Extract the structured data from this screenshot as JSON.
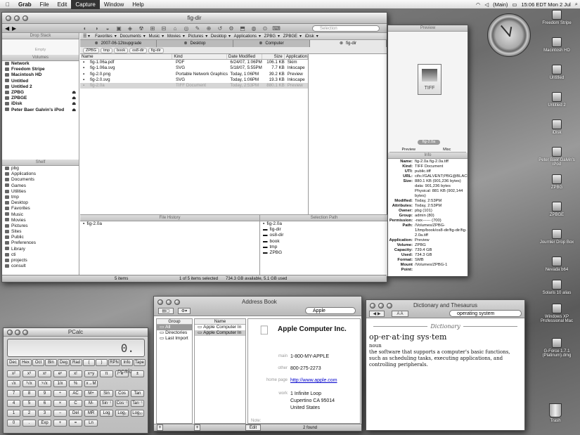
{
  "menubar": {
    "apple": "",
    "app": "Grab",
    "items": [
      "File",
      "Edit",
      "Capture",
      "Window",
      "Help"
    ],
    "clock": "15:06 EDT Mon 2 Jul",
    "main_label": "(Main)"
  },
  "pathfinder": {
    "title": "fig-dir",
    "search_placeholder": "Selection",
    "drop_stack": "Drop Stack",
    "drop_empty": "Empty",
    "volumes_label": "Volumes",
    "shelf_label": "Shelf",
    "file_history_label": "File History",
    "selection_path_label": "Selection Path",
    "preview_label": "Preview",
    "info_label": "Info",
    "tabs": [
      "2007-06-12toupgrade",
      "Desktop",
      "Computer",
      "fig-dir"
    ],
    "bookmarks": [
      "Favorites",
      "Documents",
      "Music",
      "Movies",
      "Pictures",
      "Desktop",
      "Applications",
      "ZPBG",
      "ZPBGE",
      "iDisk"
    ],
    "path": [
      "ZPBG",
      "tmp",
      "book",
      "os8-dir",
      "fig-dir"
    ],
    "volumes": [
      {
        "name": "Network",
        "bold": true
      },
      {
        "name": "Freedom Stripe",
        "bold": true
      },
      {
        "name": "Macintosh HD",
        "bold": true
      },
      {
        "name": "Untitled",
        "bold": true
      },
      {
        "name": "Untitled 2",
        "bold": true
      },
      {
        "name": "ZPBG",
        "bold": true,
        "eject": true
      },
      {
        "name": "ZPBGE",
        "bold": true,
        "eject": true
      },
      {
        "name": "iDisk",
        "bold": true,
        "eject": true
      },
      {
        "name": "Peter Baer Galvin's iPod",
        "bold": true,
        "eject": true
      }
    ],
    "shelf": [
      "pbg",
      "Applications",
      "Documents",
      "Games",
      "Utilities",
      "tmp",
      "Desktop",
      "Favorites",
      "Music",
      "Movies",
      "Pictures",
      "Sites",
      "Public",
      "Preferences",
      "Library",
      "cti",
      "projects",
      "consult"
    ],
    "columns": [
      "Name",
      "Kind",
      "Date Modified",
      "Size",
      "Application"
    ],
    "files": [
      {
        "name": "fig-1.06a.pdf",
        "kind": "PDF",
        "date": "6/24/07, 1:06PM",
        "size": "106.1 KB",
        "app": "Skim"
      },
      {
        "name": "fig-1.06a.svg",
        "kind": "SVG",
        "date": "5/18/07, 5:55PM",
        "size": "7.7 KB",
        "app": "Inkscape"
      },
      {
        "name": "fig-2.0.png",
        "kind": "Portable Network Graphics Image",
        "date": "Today, 1:06PM",
        "size": "39.2 KB",
        "app": "Preview"
      },
      {
        "name": "fig-2.0.svg",
        "kind": "SVG",
        "date": "Today, 1:06PM",
        "size": "19.3 KB",
        "app": "Inkscape"
      },
      {
        "name": "fig-2.0a",
        "kind": "TIFF Document",
        "date": "Today, 2:53PM",
        "size": "880.1 KB",
        "app": "Preview"
      }
    ],
    "file_history": [
      "fig-2.0a"
    ],
    "selection_path": [
      "fig-2.0a",
      "fig-dir",
      "os8-dir",
      "book",
      "tmp",
      "ZPBG"
    ],
    "preview_caption": "fig-2.0a",
    "preview_tabs": [
      "Preview",
      "Misc"
    ],
    "preview_icon_label": "TIFF",
    "info": [
      {
        "k": "Name:",
        "v": "fig-2.0a fig-2.0a.tiff"
      },
      {
        "k": "Kind:",
        "v": "TIFF Document"
      },
      {
        "k": "UTI:",
        "v": "public.tiff"
      },
      {
        "k": "URL:",
        "v": "cifs://GALVENT;PBG@BLACKSUN/ZPBG"
      },
      {
        "k": "Size:",
        "v": "880.1 KB (901,236 bytes) data: 901,236 bytes Physical: 881 KB (902,144 bytes)"
      },
      {
        "k": "Modified:",
        "v": "Today, 2:53PM"
      },
      {
        "k": "Attributes:",
        "v": "Today, 2:53PM"
      },
      {
        "k": "Owner:",
        "v": "pbg (101)"
      },
      {
        "k": "Group:",
        "v": "admin (80)"
      },
      {
        "k": "Permission:",
        "v": "-rwx------ (700)"
      },
      {
        "k": "Path:",
        "v": "/Volumes/ZPBG-1/tmp/book/os8-dir/fig-dir/fig-2.0a.tiff"
      },
      {
        "k": "Application:",
        "v": "Preview"
      },
      {
        "k": "Volume:",
        "v": "ZPBG"
      },
      {
        "k": "Capacity:",
        "v": "739.4 GB"
      },
      {
        "k": "Used:",
        "v": "734.3 GB"
      },
      {
        "k": "Format:",
        "v": "SMB"
      },
      {
        "k": "Mount Point:",
        "v": "/Volumes/ZPBG-1"
      }
    ],
    "status_items": "5 items",
    "status_sel": "1 of 5 items selected",
    "status_space": "734.3 GB available, 5.1 GB used"
  },
  "desktop_icons": [
    "Freedom Stripe",
    "Macintosh HD",
    "Untitled",
    "Untitled 2",
    "iDisk",
    "Peter Baer Galvin's iPod",
    "ZPBG",
    "ZPBGE",
    "Journler Drop Box",
    "Nevada b64",
    "Solaris 10 alias",
    "Windows XP Professional Mac",
    "G-Force 1.7.1 (Platinum).dmg"
  ],
  "trash": "Trash",
  "pcalc": {
    "title": "PCalc",
    "display": "0.",
    "logo": "pcalc",
    "row_modes": [
      "Dec",
      "Hex",
      "Oct",
      "Bin",
      "Deg",
      "Rad",
      "(",
      ")",
      "RPN",
      "Info",
      "Tape"
    ],
    "keys": [
      [
        "x²",
        "x³",
        "xʸ",
        "eˣ",
        "x!",
        "x÷y"
      ],
      [
        "√x",
        "³√x",
        "ʸ√x",
        "1/x",
        "%",
        "x→M"
      ],
      [
        "7",
        "8",
        "9",
        "÷",
        "AC",
        "M+",
        "Sin",
        "Cos",
        "Tan"
      ],
      [
        "4",
        "5",
        "6",
        "×",
        "C",
        "M-",
        "Sin⁻¹",
        "Cos⁻¹",
        "Tan⁻¹"
      ],
      [
        "1",
        "2",
        "3",
        "−",
        "Del",
        "MR",
        "Log",
        "Log₂",
        "Log₁₀"
      ],
      [
        "0",
        ".",
        "Exp",
        "+",
        "=",
        "Ln"
      ]
    ],
    "extra_keys": [
      "π",
      "e",
      "±"
    ]
  },
  "addressbook": {
    "title": "Address Book",
    "search": "Apple",
    "group_hdr": "Group",
    "name_hdr": "Name",
    "groups": [
      "All",
      "Directories",
      "Last Import"
    ],
    "names": [
      "Apple Computer In",
      "Apple Computer In"
    ],
    "card_name": "Apple Computer Inc.",
    "fields": [
      {
        "label": "main",
        "value": "1-800-MY-APPLE"
      },
      {
        "label": "other",
        "value": "800-275-2273"
      },
      {
        "label": "home page",
        "value": "http://www.apple.com"
      },
      {
        "label": "work",
        "value": "1 Infinite Loop"
      }
    ],
    "address_lines": [
      "Cupertino CA 95014",
      "United States"
    ],
    "note": "Note:",
    "edit": "Edit",
    "found": "2 found"
  },
  "dictionary": {
    "title": "Dictionary and Thesaurus",
    "search": "operating system",
    "tab_dictionary": "Dictionary",
    "headword": "op·er·at·ing sys·tem",
    "pos": "noun",
    "definition": "the software that supports a computer's basic functions, such as scheduling tasks, executing applications, and controlling peripherals."
  }
}
